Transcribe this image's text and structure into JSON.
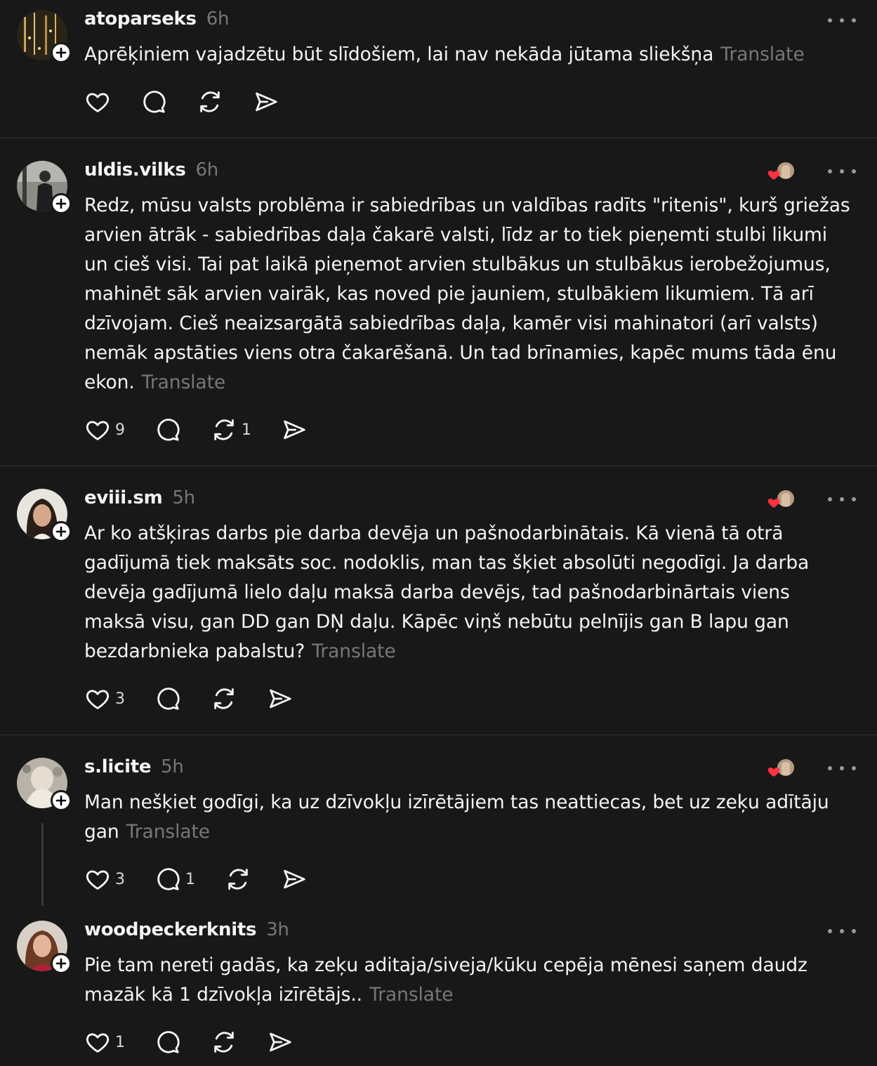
{
  "posts": [
    {
      "username": "atoparseks",
      "time": "6h",
      "text": "Aprēķiniem vajadzētu būt slīdošiem, lai nav nekāda jūtama sliekšņa",
      "translate": "Translate",
      "likes": "",
      "comments": "",
      "reposts": ""
    },
    {
      "username": "uldis.vilks",
      "time": "6h",
      "text": "Redz, mūsu valsts problēma ir sabiedrības un valdības radīts \"ritenis\", kurš griežas arvien ātrāk - sabiedrības daļa čakarē valsti, līdz ar to tiek pieņemti stulbi likumi un cieš visi. Tai pat laikā pieņemot arvien stulbākus un stulbākus ierobežojumus, mahinēt sāk arvien vairāk, kas noved pie jauniem, stulbākiem likumiem. Tā arī dzīvojam. Cieš neaizsargātā sabiedrības daļa, kamēr visi mahinatori (arī valsts) nemāk apstāties viens otra čakarēšanā. Un tad brīnamies, kapēc mums tāda ēnu ekon.",
      "translate": "Translate",
      "likes": "9",
      "comments": "",
      "reposts": "1"
    },
    {
      "username": "eviii.sm",
      "time": "5h",
      "text": "Ar ko atšķiras darbs pie darba devēja un pašnodarbinātais. Kā vienā tā otrā gadījumā tiek maksāts soc. nodoklis, man tas šķiet absolūti negodīgi. Ja darba devēja gadījumā lielo daļu maksā darba devējs, tad pašnodarbinārtais viens maksā visu, gan DD gan DŅ daļu. Kāpēc viņš nebūtu pelnījis gan B lapu gan bezdarbnieka pabalstu?",
      "translate": "Translate",
      "likes": "3",
      "comments": "",
      "reposts": ""
    },
    {
      "username": "s.licite",
      "time": "5h",
      "text": "Man nešķiet godīgi, ka uz dzīvokļu izīrētājiem tas neattiecas, bet uz zeķu adītāju gan",
      "translate": "Translate",
      "likes": "3",
      "comments": "1",
      "reposts": ""
    },
    {
      "username": "woodpeckerknits",
      "time": "3h",
      "text": "Pie tam nereti gadās, ka zeķu aditaja/siveja/kūku cepēja mēnesi saņem daudz mazāk kā 1 dzīvokļa izīrētājs..",
      "translate": "Translate",
      "likes": "1",
      "comments": "",
      "reposts": ""
    }
  ],
  "icons": {
    "like": "heart-icon",
    "comment": "comment-icon",
    "repost": "repost-icon",
    "share": "share-icon",
    "more": "more-icon",
    "follow": "plus-icon"
  },
  "colors": {
    "background": "#181818",
    "text": "#f3f5f7",
    "muted": "#777777",
    "heart": "#ff3040"
  }
}
